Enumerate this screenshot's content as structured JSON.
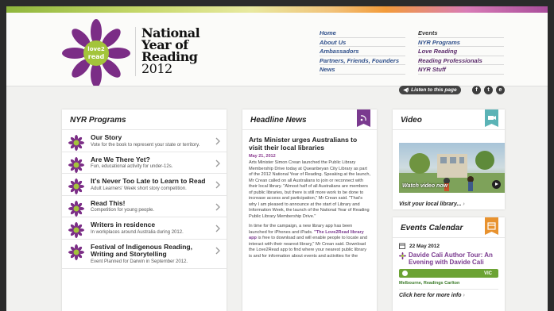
{
  "header": {
    "logo_text": "love2read",
    "title_lines": [
      "National",
      "Year of",
      "Reading",
      "2012"
    ],
    "nav_col1": [
      "Home",
      "About Us",
      "Ambassadors",
      "Partners, Friends, Founders",
      "News"
    ],
    "nav_col2": [
      "Events",
      "NYR Programs",
      "Love Reading",
      "Reading Professionals",
      "NYR Stuff"
    ]
  },
  "utility": {
    "listen_label": "Listen to this page",
    "social": [
      "f",
      "t",
      "e"
    ]
  },
  "programs": {
    "title": "NYR Programs",
    "items": [
      {
        "title": "Our Story",
        "desc": "Vote for the book to represent your state or territory."
      },
      {
        "title": "Are We There Yet?",
        "desc": "Fun, educational activity for under-12s."
      },
      {
        "title": "It's Never Too Late to Learn to Read",
        "desc": "Adult Learners' Week short story competition."
      },
      {
        "title": "Read This!",
        "desc": "Competition for young people."
      },
      {
        "title": "Writers in residence",
        "desc": "In workplaces around Australia during 2012."
      },
      {
        "title": "Festival of Indigenous Reading, Writing and Storytelling",
        "desc": "Event Planned for Darwin in September 2012."
      }
    ]
  },
  "news": {
    "title": "Headline News",
    "headline": "Arts Minister urges Australians to visit their local libraries",
    "date": "May 21, 2012",
    "para1": "Arts Minister Simon Crean launched the Public Library Membership Drive today at Queanbeyan City Library as part of the 2012 National Year of Reading. Speaking at the launch, Mr Crean called on all Australians to join or reconnect with their local library. \"Almost half of all Australians are members of public libraries, but there is still more work to be done to increase access and participation,\" Mr Crean said. \"That's why I am pleased to announce at the start of Library and Information Week, the launch of the National Year of Reading Public Library Membership Drive.\"",
    "para2_a": "In time for the campaign, a new library app has been launched for iPhones and iPads. ",
    "para2_link": "\"The Love2Read library app",
    "para2_b": " is free to download and will enable people to locate and interact with their nearest library,\" Mr Crean said. Download the Love2Read app to find where your nearest public library is and for information about events and activities for the"
  },
  "video": {
    "title": "Video",
    "watch_label": "Watch video now",
    "link_label": "Visit your local library..."
  },
  "events": {
    "title": "Events Calendar",
    "date": "22 May 2012",
    "event_title": "Davide Cali Author Tour: An Evening with Davide Cali",
    "state": "VIC",
    "venue": "Melbourne, Readings Carlton",
    "more_label": "Click here for more info"
  },
  "colors": {
    "purple": "#7a3a8f",
    "teal": "#5bb3b6",
    "orange": "#e8922e",
    "green": "#6ca334",
    "nav_blue": "#2f4f8a"
  }
}
